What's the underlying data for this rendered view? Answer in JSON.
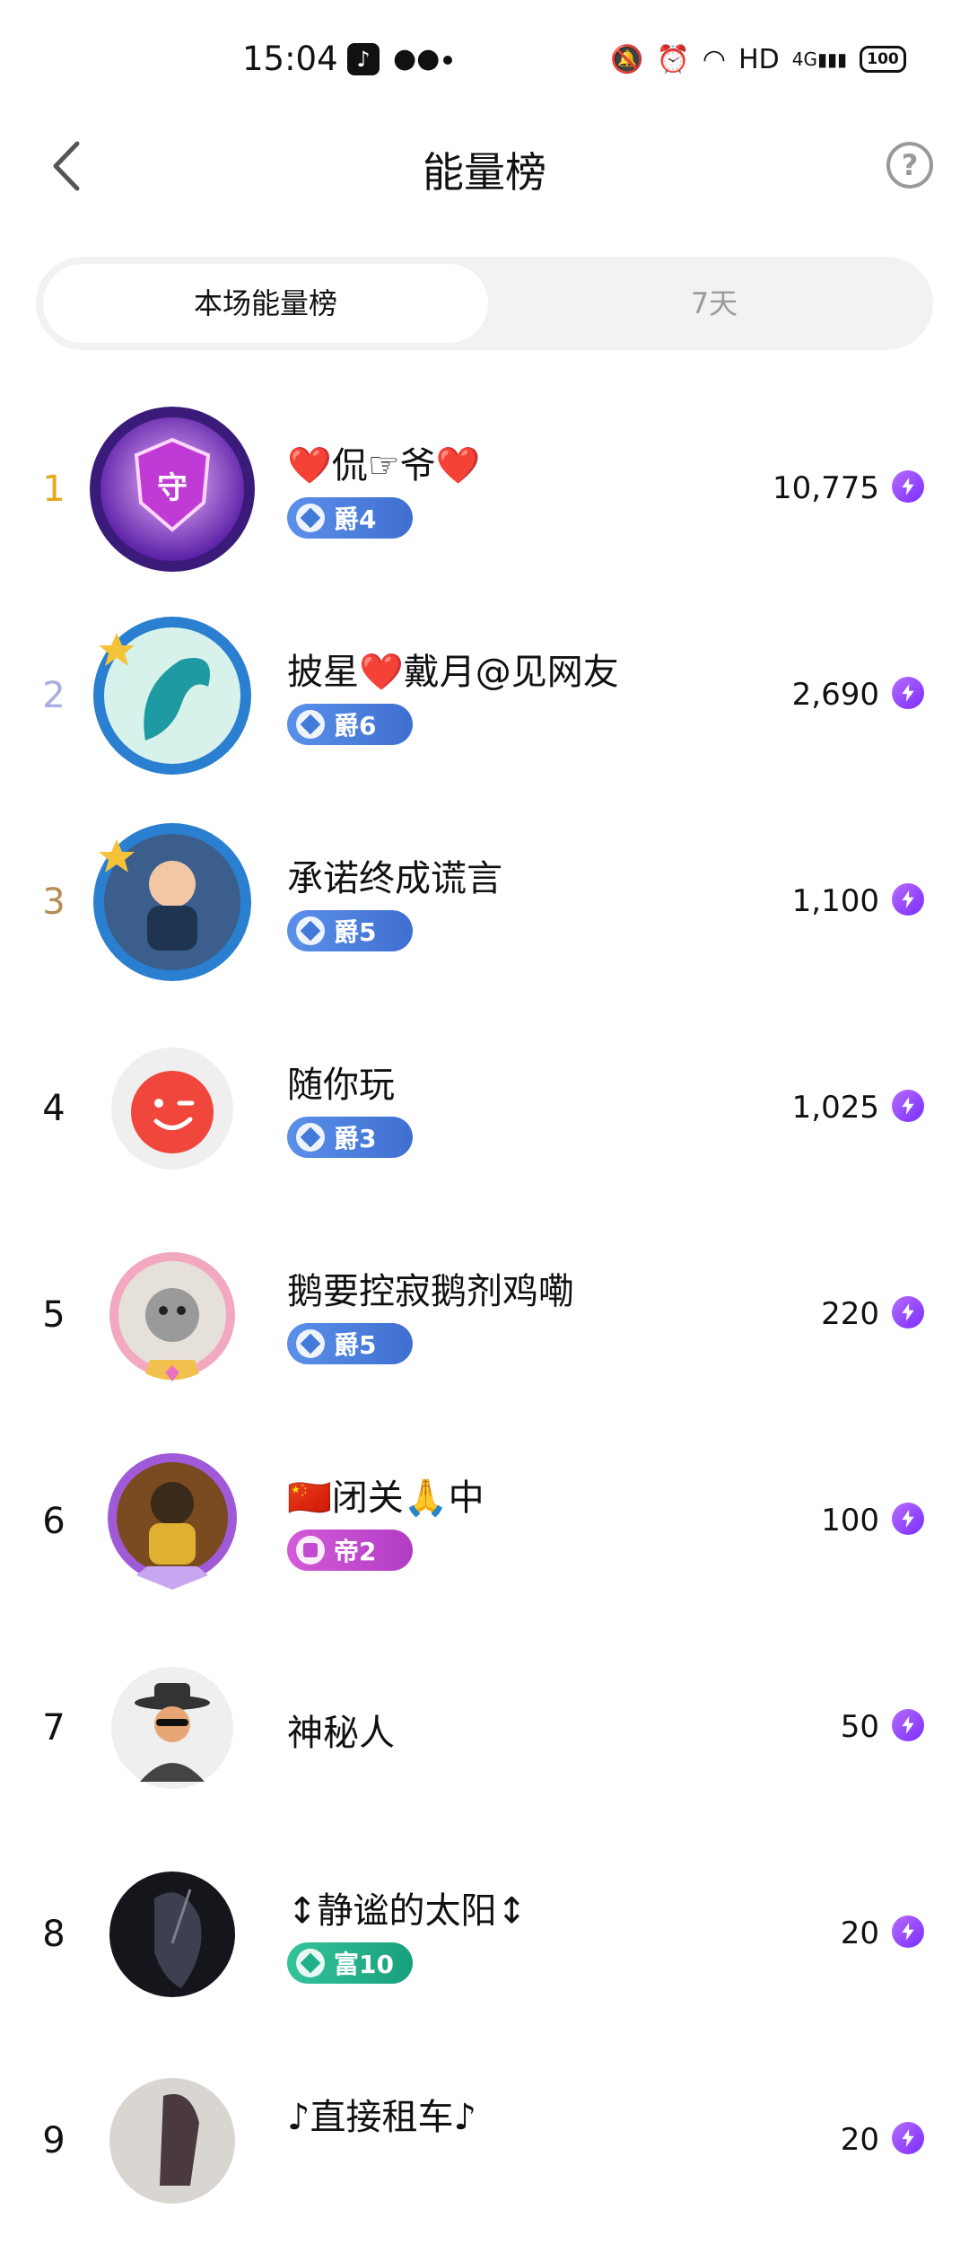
{
  "status_bar": {
    "time": "15:04",
    "tiktok_icon": "tiktok-icon",
    "wechat_icon": "wechat-icon",
    "network": "HD",
    "cell": "4G",
    "battery": "100"
  },
  "header": {
    "title": "能量榜"
  },
  "tabs": [
    {
      "label": "本场能量榜",
      "active": true
    },
    {
      "label": "7天",
      "active": false
    }
  ],
  "colors": {
    "rank1": "#e6a820",
    "rank2": "#a8aee0",
    "rank3": "#b88a55",
    "rank_default": "#111111",
    "badge_jue": "#3f79d8",
    "badge_di": "#c24bd1",
    "badge_fu": "#1fae8a",
    "energy_icon": "#8a3cff"
  },
  "ranking": [
    {
      "rank": "1",
      "name": "❤️侃☞爷❤️",
      "badge": "爵4",
      "badge_type": "jue",
      "score": "10,775"
    },
    {
      "rank": "2",
      "name": "披星❤️戴月@见网友",
      "badge": "爵6",
      "badge_type": "jue",
      "score": "2,690"
    },
    {
      "rank": "3",
      "name": "承诺终成谎言",
      "badge": "爵5",
      "badge_type": "jue",
      "score": "1,100"
    },
    {
      "rank": "4",
      "name": "随你玩",
      "badge": "爵3",
      "badge_type": "jue",
      "score": "1,025"
    },
    {
      "rank": "5",
      "name": "鹅要控寂鹅剂鸡嘞",
      "badge": "爵5",
      "badge_type": "jue",
      "score": "220"
    },
    {
      "rank": "6",
      "name": "🇨🇳闭关🙏中",
      "badge": "帝2",
      "badge_type": "di",
      "score": "100"
    },
    {
      "rank": "7",
      "name": "神秘人",
      "badge": "",
      "badge_type": "",
      "score": "50"
    },
    {
      "rank": "8",
      "name": "↕静谧的太阳↕",
      "badge": "富10",
      "badge_type": "fu",
      "score": "20"
    },
    {
      "rank": "9",
      "name": "♪直接租车♪",
      "badge": "",
      "badge_type": "",
      "score": "20"
    }
  ]
}
